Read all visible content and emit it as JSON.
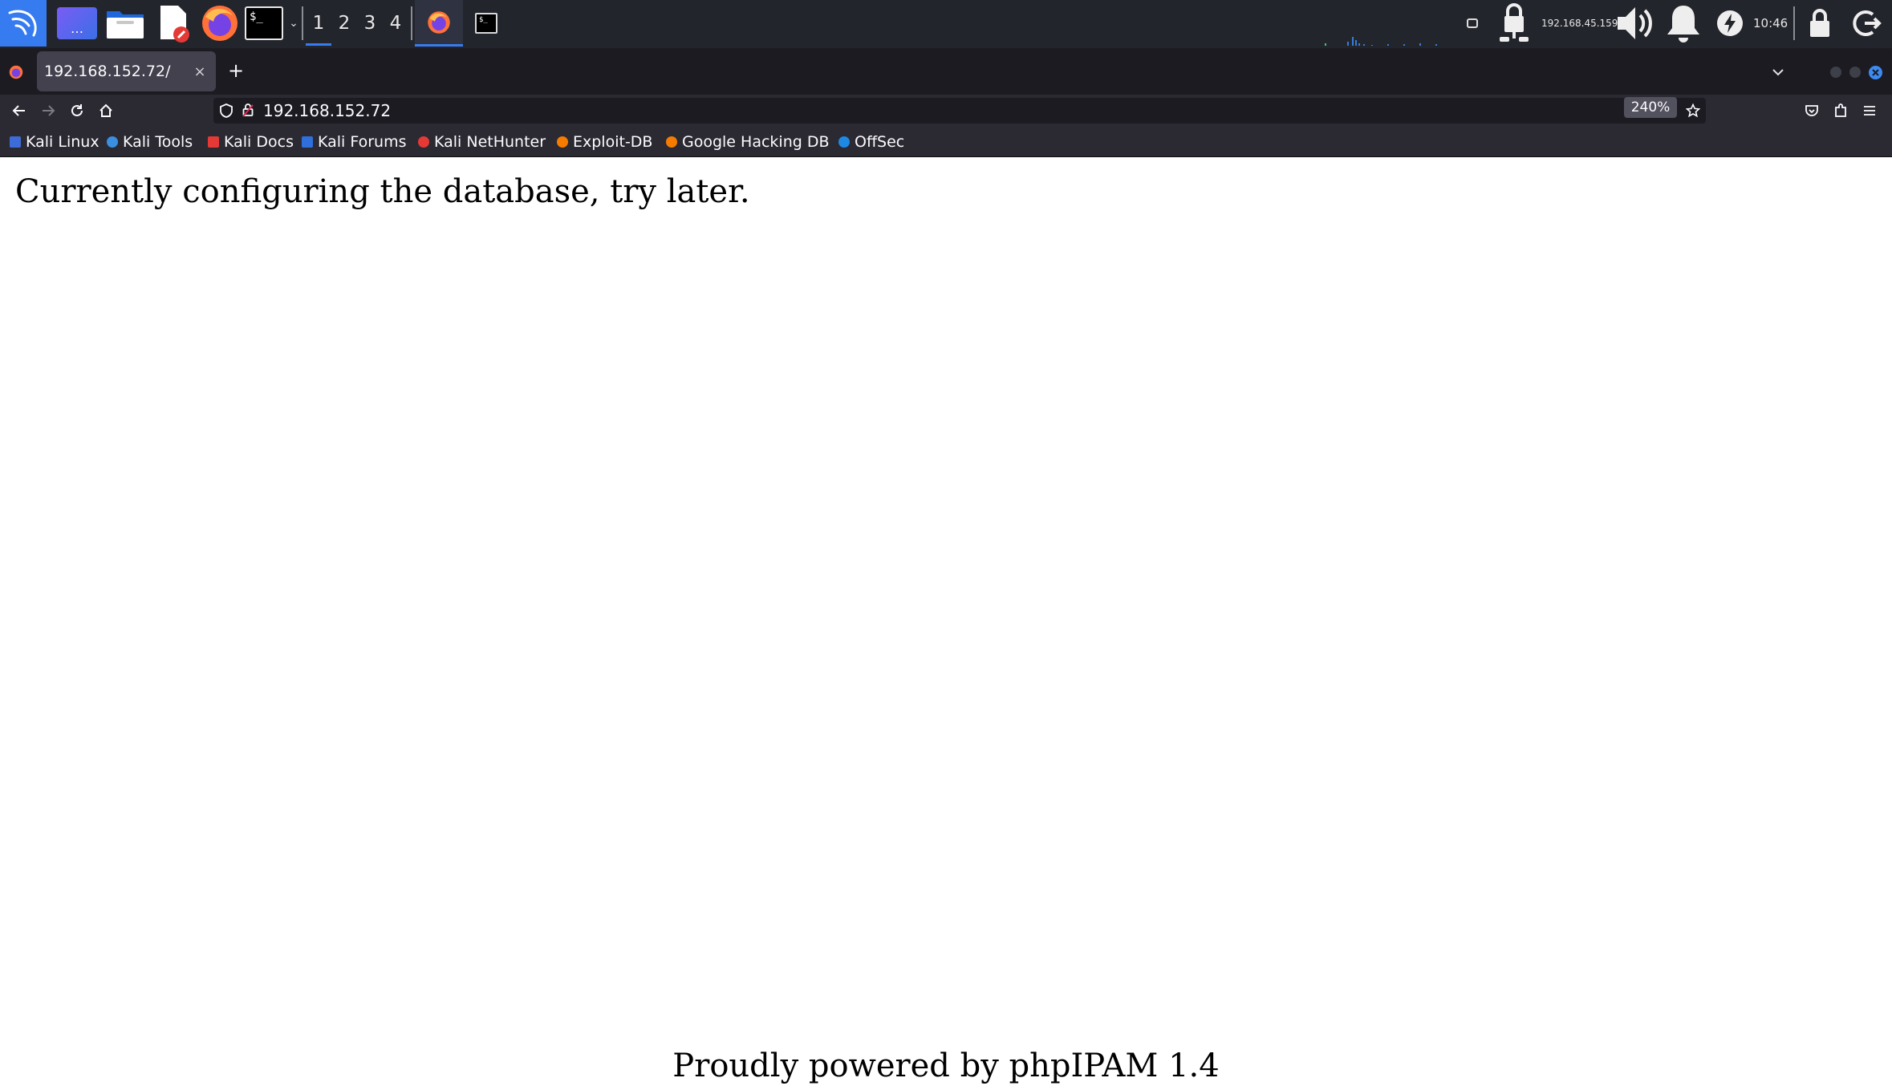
{
  "taskbar": {
    "workspaces": [
      "1",
      "2",
      "3",
      "4"
    ],
    "active_workspace": "1",
    "network_ip": "192.168.45.159",
    "clock": "10:46"
  },
  "browser": {
    "tab_title": "192.168.152.72/",
    "new_tab_label": "+",
    "close_tab_label": "×",
    "url": "192.168.152.72",
    "zoom": "240%",
    "bookmarks": [
      {
        "label": "Kali Linux",
        "color": "#3d6bd8"
      },
      {
        "label": "Kali Tools",
        "color": "#3a8fe0"
      },
      {
        "label": "Kali Docs",
        "color": "#e53935"
      },
      {
        "label": "Kali Forums",
        "color": "#2f6fdc"
      },
      {
        "label": "Kali NetHunter",
        "color": "#e53935"
      },
      {
        "label": "Exploit-DB",
        "color": "#f57c00"
      },
      {
        "label": "Google Hacking DB",
        "color": "#f57c00"
      },
      {
        "label": "OffSec",
        "color": "#1e88e5"
      }
    ]
  },
  "page": {
    "message": "Currently configuring the database, try later.",
    "footer": "Proudly powered by phpIPAM 1.4"
  },
  "colors": {
    "panel": "#23252c",
    "tabbar": "#1c1b22",
    "toolbar": "#2b2a33",
    "accent": "#367bf0"
  }
}
